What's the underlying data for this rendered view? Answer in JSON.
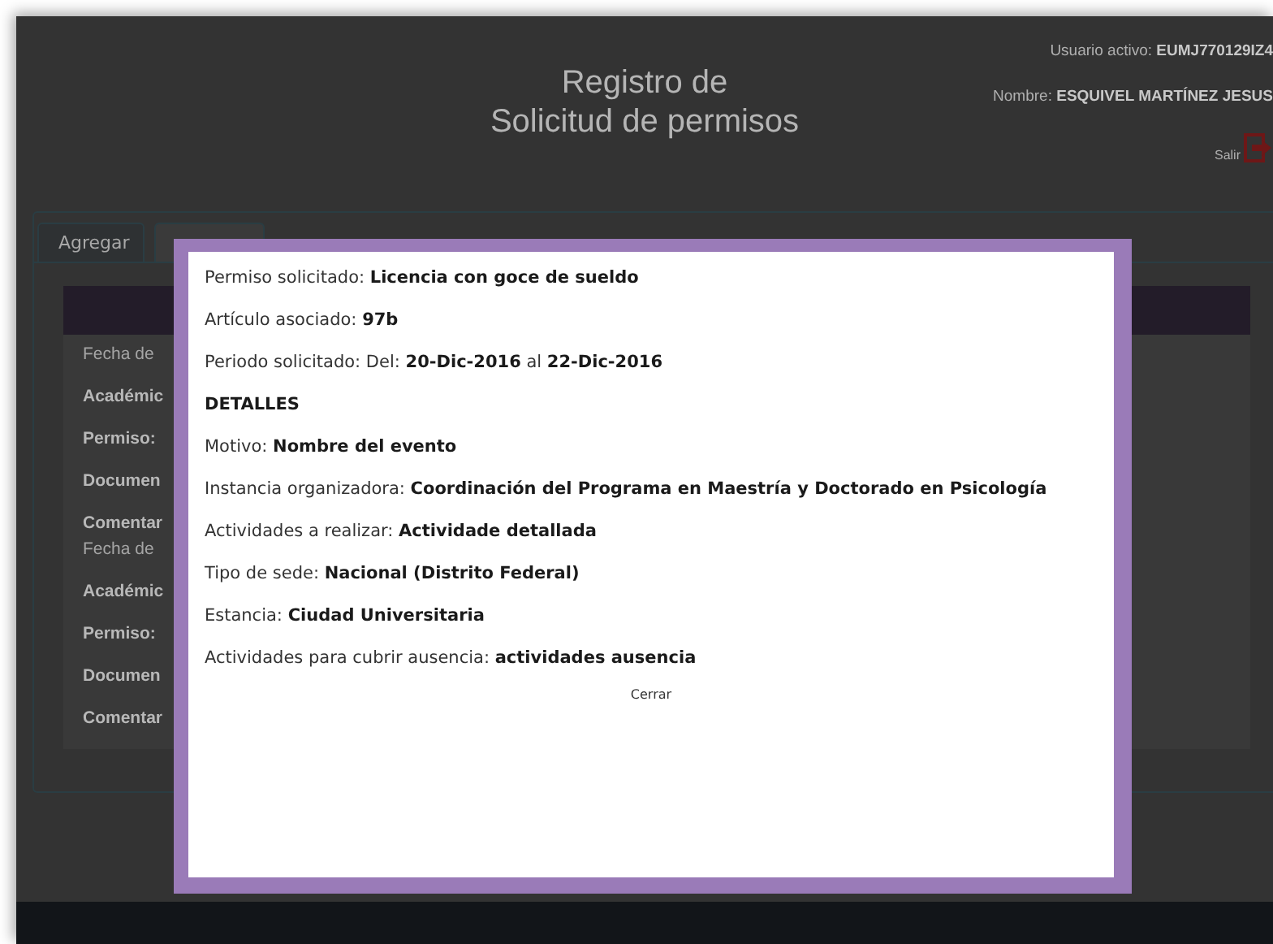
{
  "header": {
    "title_lines": [
      "Registro de",
      "Solicitud de permisos"
    ],
    "user_label": "Usuario activo:",
    "user_value": "EUMJ770129IZ4",
    "name_label": "Nombre:",
    "name_value": "ESQUIVEL MARTÍNEZ JESUS",
    "logout_label": "Salir"
  },
  "tabs": [
    {
      "label": "Agregar",
      "selected": false
    },
    {
      "selected": true
    }
  ],
  "records": [
    {
      "kind": "plain",
      "text": "Fecha de"
    },
    {
      "kind": "bold",
      "text": "Académic"
    },
    {
      "kind": "bold",
      "text": "Permiso:"
    },
    {
      "kind": "bold",
      "text": "Documen"
    },
    {
      "kind": "bold",
      "text": "Comentar"
    },
    {
      "kind": "plain",
      "text": "Fecha de"
    },
    {
      "kind": "bold",
      "text": "Académic"
    },
    {
      "kind": "bold",
      "text": "Permiso:"
    },
    {
      "kind": "bold",
      "text": "Documen"
    },
    {
      "kind": "bold",
      "text": "Comentar"
    }
  ],
  "dialog": {
    "lines": [
      {
        "kind": "field",
        "text": "Permiso solicitado: **Licencia con goce de sueldo**"
      },
      {
        "kind": "field",
        "text": "Artículo asociado: **97b**"
      },
      {
        "kind": "field",
        "text": "Periodo solicitado: Del:  **20-Dic-2016** al **22-Dic-2016**"
      },
      {
        "kind": "heading",
        "text": "DETALLES"
      },
      {
        "kind": "field",
        "text": "Motivo:  **Nombre del evento**"
      },
      {
        "kind": "field",
        "text": "Instancia organizadora: **Coordinación del Programa en Maestría y Doctorado en Psicología**"
      },
      {
        "kind": "field",
        "text": "Actividades a realizar: **Actividade detallada**"
      },
      {
        "kind": "field",
        "text": "Tipo de sede: **Nacional (Distrito Federal)**"
      },
      {
        "kind": "field",
        "text": "Estancia: **Ciudad Universitaria**"
      },
      {
        "kind": "field",
        "text": "Actividades para cubrir ausencia: **actividades ausencia**"
      }
    ],
    "close_label": "Cerrar"
  }
}
